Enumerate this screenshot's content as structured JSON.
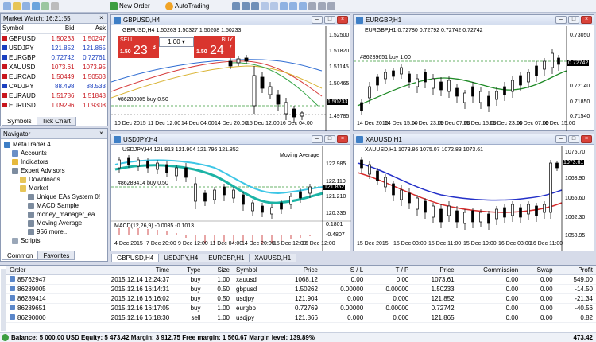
{
  "toolbar": {
    "new_order": "New Order",
    "auto_trading": "AutoTrading"
  },
  "market_watch": {
    "title": "Market Watch: 16:21:55",
    "headers": {
      "symbol": "Symbol",
      "bid": "Bid",
      "ask": "Ask"
    },
    "rows": [
      {
        "symbol": "GBPUSD",
        "bid": "1.50233",
        "ask": "1.50247",
        "color": "#c8161d"
      },
      {
        "symbol": "USDJPY",
        "bid": "121.852",
        "ask": "121.865",
        "color": "#1a3fbf"
      },
      {
        "symbol": "EURGBP",
        "bid": "0.72742",
        "ask": "0.72761",
        "color": "#1a3fbf"
      },
      {
        "symbol": "XAUUSD",
        "bid": "1073.61",
        "ask": "1073.95",
        "color": "#c8161d"
      },
      {
        "symbol": "EURCAD",
        "bid": "1.50449",
        "ask": "1.50503",
        "color": "#c8161d"
      },
      {
        "symbol": "CADJPY",
        "bid": "88.498",
        "ask": "88.533",
        "color": "#1a3fbf"
      },
      {
        "symbol": "EURAUD",
        "bid": "1.51786",
        "ask": "1.51848",
        "color": "#c8161d"
      },
      {
        "symbol": "EURUSD",
        "bid": "1.09296",
        "ask": "1.09308",
        "color": "#c8161d"
      }
    ],
    "tabs": [
      "Symbols",
      "Tick Chart"
    ]
  },
  "navigator": {
    "title": "Navigator",
    "items": [
      "MetaTrader 4",
      "Accounts",
      "Indicators",
      "Expert Advisors",
      "Downloads",
      "Market",
      "Unique EAs System 0!",
      "MACD Sample",
      "money_manager_ea",
      "Moving Average",
      "956 more...",
      "Scripts"
    ],
    "tabs": [
      "Common",
      "Favorites"
    ]
  },
  "charts": {
    "gbpusd": {
      "title": "GBPUSD,H4",
      "info": "GBPUSD,H4  1.50263 1.50327 1.50208 1.50233",
      "sell_label": "SELL",
      "buy_label": "BUY",
      "lot": "1.00",
      "sell_small": "1.50",
      "sell_big": "23",
      "sell_sup": "3",
      "buy_small": "1.50",
      "buy_big": "24",
      "buy_sup": "7",
      "order_line": "#86289005 buy 0.50",
      "prices": [
        "1.52500",
        "1.51820",
        "1.51145",
        "1.50465",
        "1.50233",
        "1.49785"
      ],
      "times": [
        "10 Dec 2015",
        "11 Dec 12:00",
        "14 Dec 04:00",
        "14 Dec 20:00",
        "15 Dec 12:00",
        "16 Dec 04:00"
      ]
    },
    "eurgbp": {
      "title": "EURGBP,H1",
      "info": "EURGBP,H1  0.72780 0.72792 0.72742 0.72742",
      "order_line": "#86289651 buy 1.00",
      "prices": [
        "0.73050",
        "0.72742",
        "0.72140",
        "0.71850",
        "0.71540"
      ],
      "times": [
        "14 Dec 2015",
        "14 Dec 15:00",
        "14 Dec 23:00",
        "15 Dec 07:00",
        "15 Dec 15:00",
        "15 Dec 23:00",
        "16 Dec 07:00",
        "16 Dec 15:00"
      ]
    },
    "usdjpy": {
      "title": "USDJPY,H4",
      "info": "USDJPY,H4  121.813 121.904 121.796 121.852",
      "indicator": "Moving Average",
      "order_line": "#86289414 buy 0.50",
      "macd_label": "MACD(12,26,9) -0.0035 -0.1013",
      "prices": [
        "122.985",
        "122.110",
        "121.852",
        "121.210",
        "120.335",
        "0.1801",
        "-0.4807"
      ],
      "times": [
        "4 Dec 2015",
        "7 Dec 20:00",
        "9 Dec 12:00",
        "11 Dec 04:00",
        "14 Dec 20:00",
        "15 Dec 12:00",
        "16 Dec 12:00"
      ]
    },
    "xauusd": {
      "title": "XAUUSD,H1",
      "info": "XAUUSD,H1  1073.86 1075.07 1072.83 1073.61",
      "prices": [
        "1075.70",
        "1073.61",
        "1068.90",
        "1065.60",
        "1062.30",
        "1058.95"
      ],
      "times": [
        "15 Dec 2015",
        "15 Dec 03:00",
        "15 Dec 11:00",
        "15 Dec 19:00",
        "16 Dec 03:00",
        "16 Dec 11:00"
      ]
    }
  },
  "chart_tabs": [
    "GBPUSD,H4",
    "USDJPY,H4",
    "EURGBP,H1",
    "XAUUSD,H1"
  ],
  "orders": {
    "headers": [
      "Order",
      "Time",
      "Type",
      "Size",
      "Symbol",
      "Price",
      "S / L",
      "T / P",
      "Price",
      "Commission",
      "Swap",
      "Profit"
    ],
    "rows": [
      [
        "85762947",
        "2015.12.14 12:24:37",
        "buy",
        "1.00",
        "xauusd",
        "1068.12",
        "0.00",
        "0.00",
        "1073.61",
        "0.00",
        "0.00",
        "549.00"
      ],
      [
        "86289005",
        "2015.12.16 16:14:31",
        "buy",
        "0.50",
        "gbpusd",
        "1.50262",
        "0.00000",
        "0.00000",
        "1.50233",
        "0.00",
        "0.00",
        "-14.50"
      ],
      [
        "86289414",
        "2015.12.16 16:16:02",
        "buy",
        "0.50",
        "usdjpy",
        "121.904",
        "0.000",
        "0.000",
        "121.852",
        "0.00",
        "0.00",
        "-21.34"
      ],
      [
        "86289651",
        "2015.12.16 16:17:05",
        "buy",
        "1.00",
        "eurgbp",
        "0.72769",
        "0.00000",
        "0.00000",
        "0.72742",
        "0.00",
        "0.00",
        "-40.56"
      ],
      [
        "86290000",
        "2015.12.16 16:18:30",
        "sell",
        "1.00",
        "usdjpy",
        "121.866",
        "0.000",
        "0.000",
        "121.865",
        "0.00",
        "0.00",
        "0.82"
      ]
    ],
    "balance": "Balance: 5 000.00 USD  Equity: 5 473.42  Margin: 3 912.75  Free margin: 1 560.67  Margin level: 139.89%",
    "total": "473.42"
  }
}
